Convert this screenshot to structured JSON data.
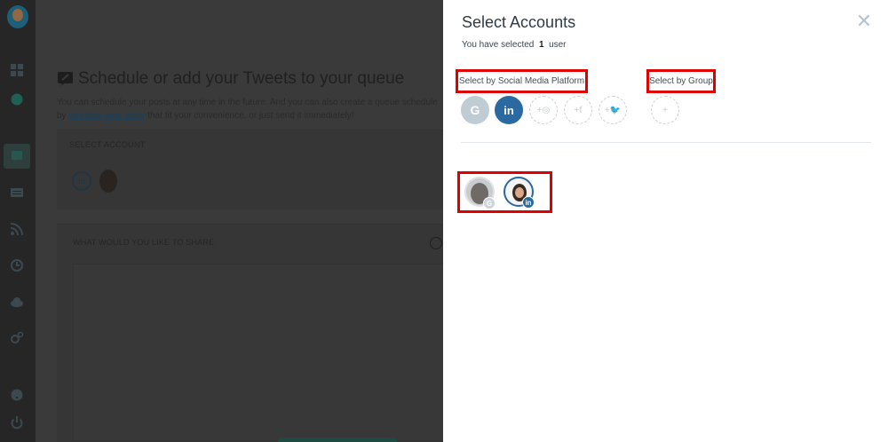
{
  "background_page": {
    "title": "Schedule or add your Tweets to your queue",
    "description_prefix": "You can schedule your posts at any time in the future. And you can also create a queue schedule by",
    "description_link": "posting-time slots",
    "description_suffix": "that fit your convenience, or just send it immediately!",
    "select_account_label": "SELECT ACCOUNT",
    "share_label": "WHAT WOULD YOU LIKE TO SHARE",
    "mini_linkedin": "in"
  },
  "sidebar": {
    "icons": [
      "logo-icon",
      "dashboard-icon",
      "info-icon",
      "compose-icon",
      "posts-icon",
      "rss-icon",
      "history-icon",
      "cloud-upload-icon",
      "settings-icon",
      "help-icon",
      "power-icon"
    ]
  },
  "modal": {
    "title": "Select Accounts",
    "selected_prefix": "You have selected",
    "selected_count": "1",
    "selected_suffix": "user",
    "close_glyph": "✕",
    "platform_label": "Select by Social Media Platform",
    "group_label": "Select by Group",
    "platforms": {
      "google": "G",
      "linkedin": "in",
      "instagram": "+◎",
      "facebook": "+f",
      "twitter": "+🐦"
    },
    "group_add": "+",
    "account_badges": {
      "google": "G",
      "linkedin": "in"
    },
    "highlight_color": "#e00000",
    "linkedin_color": "#2a6aa0"
  }
}
